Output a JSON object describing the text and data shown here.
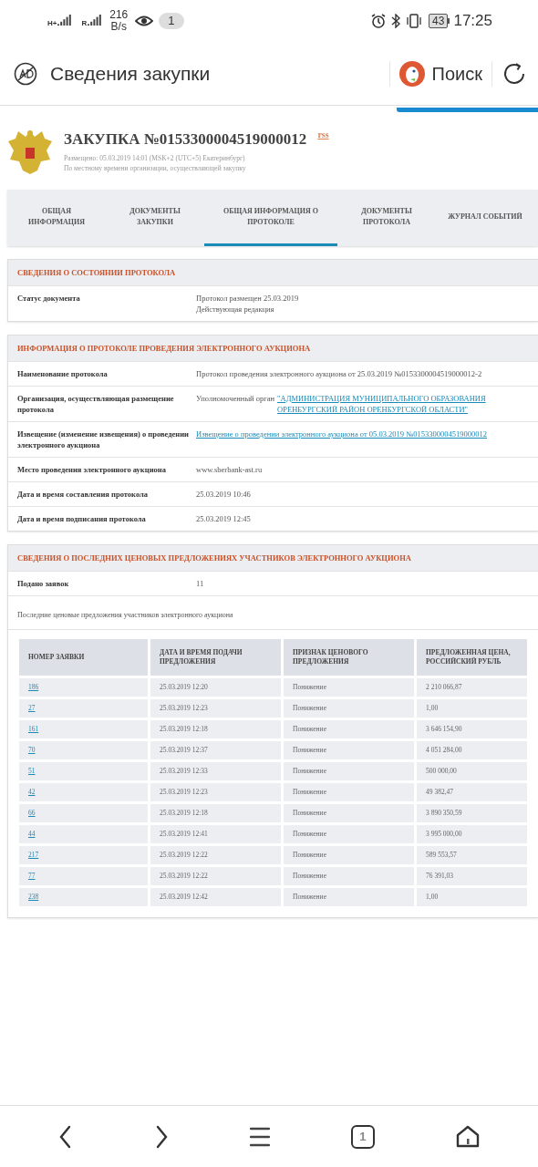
{
  "status_bar": {
    "net_labels": [
      "H+",
      "R"
    ],
    "speed": "216",
    "speed_unit": "B/s",
    "badge": "1",
    "battery": "43",
    "time": "17:25"
  },
  "browser_bar": {
    "title": "Сведения закупки",
    "search": "Поиск"
  },
  "header": {
    "title": "ЗАКУПКА №0153300004519000012",
    "rss": "rss",
    "posted": "Размещено: 05.03.2019 14:01 (MSK+2 (UTC+5) Екатеринбург)",
    "note": "По местному времени организации, осуществляющей закупку"
  },
  "tabs": [
    {
      "label": "ОБЩАЯ ИНФОРМАЦИЯ",
      "selected": false
    },
    {
      "label": "ДОКУМЕНТЫ ЗАКУПКИ",
      "selected": false
    },
    {
      "label": "ОБЩАЯ ИНФОРМАЦИЯ О ПРОТОКОЛЕ",
      "selected": true
    },
    {
      "label": "ДОКУМЕНТЫ ПРОТОКОЛА",
      "selected": false
    },
    {
      "label": "ЖУРНАЛ СОБЫТИЙ",
      "selected": false
    }
  ],
  "sections": [
    {
      "title": "СВЕДЕНИЯ О СОСТОЯНИИ ПРОТОКОЛА",
      "rows": [
        {
          "kind": "pair",
          "label": "Статус документа",
          "lines": [
            "Протокол размещен 25.03.2019",
            "Действующая редакция"
          ]
        }
      ]
    },
    {
      "title": "ИНФОРМАЦИЯ О ПРОТОКОЛЕ ПРОВЕДЕНИЯ ЭЛЕКТРОННОГО АУКЦИОНА",
      "rows": [
        {
          "kind": "pair",
          "label": "Наименование протокола",
          "lines": [
            "Протокол проведения электронного аукциона от 25.03.2019 №0153300004519000012-2"
          ]
        },
        {
          "kind": "pair",
          "label": "Организация, осуществляющая размещение протокола",
          "prefix": "Уполномоченный орган",
          "link": "\"АДМИНИСТРАЦИЯ МУНИЦИПАЛЬНОГО ОБРАЗОВАНИЯ ОРЕНБУРГСКИЙ РАЙОН ОРЕНБУРГСКОЙ ОБЛАСТИ\""
        },
        {
          "kind": "pair",
          "label": "Извещение (изменение извещения) о проведении электронного аукциона",
          "link": "Извещение о проведении электронного аукциона от 05.03.2019 №0153300004519000012"
        },
        {
          "kind": "pair",
          "label": "Место проведения электронного аукциона",
          "lines": [
            "www.sberbank-ast.ru"
          ]
        },
        {
          "kind": "pair",
          "label": "Дата и время составления протокола",
          "lines": [
            "25.03.2019 10:46"
          ]
        },
        {
          "kind": "pair",
          "label": "Дата и время подписания протокола",
          "lines": [
            "25.03.2019 12:45"
          ]
        }
      ]
    },
    {
      "title": "СВЕДЕНИЯ О ПОСЛЕДНИХ ЦЕНОВЫХ ПРЕДЛОЖЕНИЯХ УЧАСТНИКОВ ЭЛЕКТРОННОГО АУКЦИОНА",
      "rows": [
        {
          "kind": "pair",
          "label": "Подано заявок",
          "lines": [
            "11"
          ]
        },
        {
          "kind": "note",
          "text": "Последние ценовые предложения участников электронного аукциона"
        },
        {
          "kind": "table",
          "columns": [
            "НОМЕР ЗАЯВКИ",
            "ДАТА И ВРЕМЯ ПОДАЧИ ПРЕДЛОЖЕНИЯ",
            "ПРИЗНАК ЦЕНОВОГО ПРЕДЛОЖЕНИЯ",
            "ПРЕДЛОЖЕННАЯ ЦЕНА, РОССИЙСКИЙ РУБЛЬ"
          ],
          "rows": [
            [
              "186",
              "25.03.2019 12:20",
              "Понижение",
              "2 210 066,87"
            ],
            [
              "27",
              "25.03.2019 12:23",
              "Понижение",
              "1,00"
            ],
            [
              "161",
              "25.03.2019 12:18",
              "Понижение",
              "3 646 154,90"
            ],
            [
              "70",
              "25.03.2019 12:37",
              "Понижение",
              "4 051 284,00"
            ],
            [
              "51",
              "25.03.2019 12:33",
              "Понижение",
              "500 000,00"
            ],
            [
              "42",
              "25.03.2019 12:23",
              "Понижение",
              "49 382,47"
            ],
            [
              "66",
              "25.03.2019 12:18",
              "Понижение",
              "3 890 350,59"
            ],
            [
              "44",
              "25.03.2019 12:41",
              "Понижение",
              "3 995 000,00"
            ],
            [
              "217",
              "25.03.2019 12:22",
              "Понижение",
              "589 553,57"
            ],
            [
              "77",
              "25.03.2019 12:22",
              "Понижение",
              "76 391,03"
            ],
            [
              "238",
              "25.03.2019 12:42",
              "Понижение",
              "1,00"
            ]
          ]
        }
      ]
    }
  ],
  "bottom_nav": {
    "tab_count": "1"
  }
}
